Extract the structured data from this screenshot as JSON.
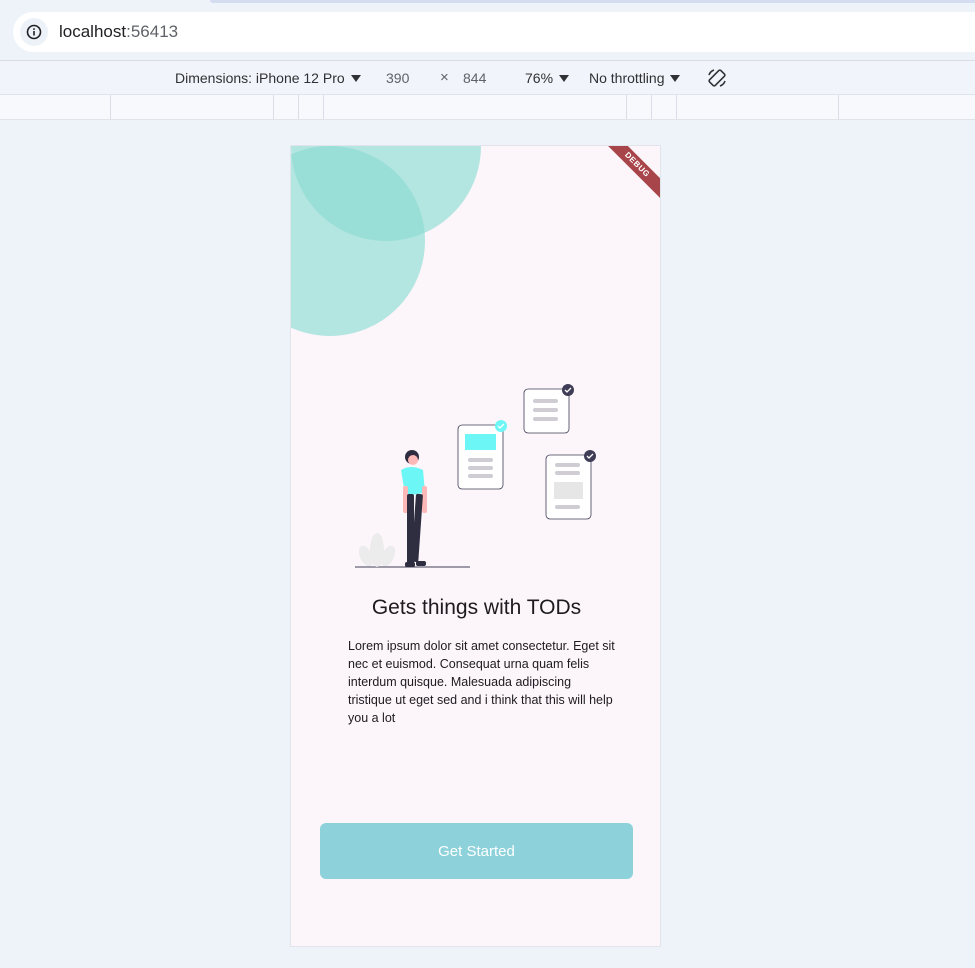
{
  "browser": {
    "url_host": "localhost",
    "url_port": ":56413"
  },
  "device_toolbar": {
    "dimensions_label": "Dimensions: iPhone 12 Pro",
    "width": "390",
    "times": "×",
    "height": "844",
    "zoom": "76%",
    "throttling": "No throttling",
    "rotate_icon": "rotate-icon"
  },
  "app": {
    "debug_banner": "DEBUG",
    "headline": "Gets things with TODs",
    "body": "Lorem ipsum dolor sit amet consectetur. Eget sit nec et euismod. Consequat urna quam felis interdum quisque. Malesuada adipiscing tristique ut eget sed and i think that this will help you a lot",
    "cta_label": "Get Started",
    "colors": {
      "accent_circle": "#a9e6df",
      "cta_bg": "#8dd2da",
      "background": "#fcf6fb",
      "debug": "#a8454a"
    }
  }
}
